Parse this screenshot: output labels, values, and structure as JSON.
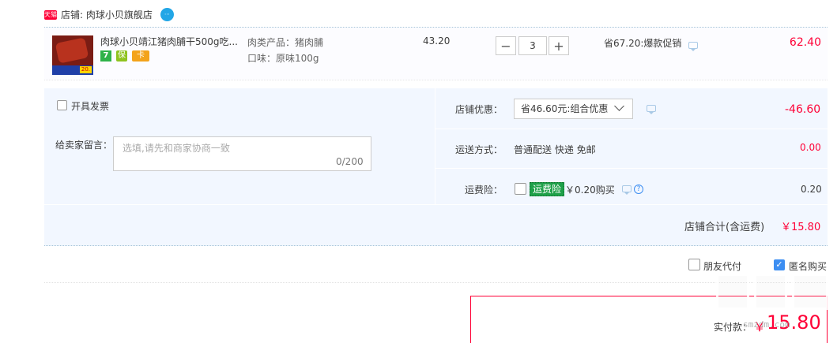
{
  "store": {
    "badge": "天猫",
    "label": "店铺: 肉球小贝旗舰店",
    "chat_icon": "wangwang-chat-icon"
  },
  "item": {
    "title": "肉球小贝靖江猪肉脯干500g吃...",
    "thumb_tag": "20.",
    "services": [
      "7",
      "保",
      "卡"
    ],
    "sku_line1": "肉类产品：猪肉脯",
    "sku_line2": "口味：原味100g",
    "unit_price": "43.20",
    "quantity": "3",
    "qty_minus": "−",
    "qty_plus": "+",
    "promo": "省67.20:爆款促销",
    "total": "62.40"
  },
  "options": {
    "invoice": "开具发票",
    "message_label": "给卖家留言：",
    "message_placeholder": "选填,请先和商家协商一致",
    "message_count": "0/200",
    "shop_discount_label": "店铺优惠：",
    "shop_discount_value": "省46.60元:组合优惠",
    "shop_discount_amount": "-46.60",
    "shipping_label": "运送方式：",
    "shipping_value": "普通配送 快递 免邮",
    "shipping_amount": "0.00",
    "insurance_label": "运费险：",
    "insurance_badge": "运费险",
    "insurance_price": "￥0.20购买",
    "insurance_help": "?",
    "insurance_amount": "0.20"
  },
  "subtotal": {
    "label": "店铺合计(含运费)",
    "value": "￥15.80"
  },
  "checkout_options": {
    "friend_pay": "朋友代付",
    "anonymous": "匿名购买",
    "anonymous_checked": true
  },
  "payment": {
    "label": "实付款：",
    "currency": "￥",
    "value": "15.80"
  },
  "watermark": {
    "text": "值 什么值得买",
    "url": "smzdm.com"
  },
  "colors": {
    "price_red": "#ff0036",
    "panel_blue": "#f2f7ff",
    "checkbox_blue": "#3c8ef2",
    "insurance_green": "#1fa049"
  }
}
